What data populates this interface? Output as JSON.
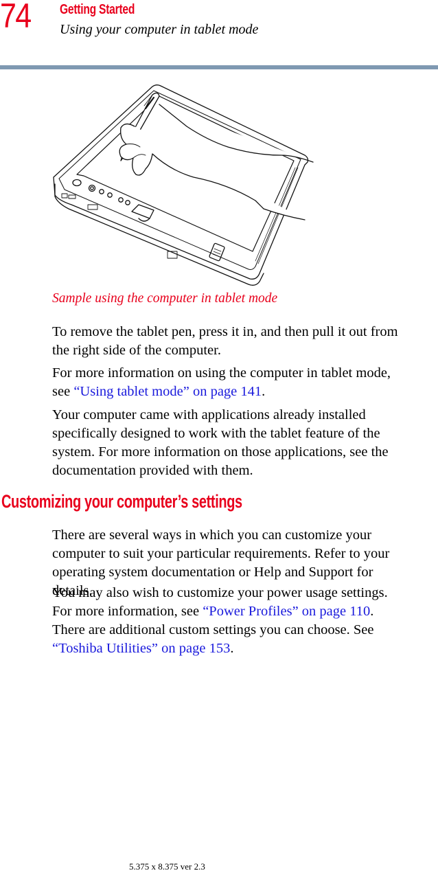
{
  "header": {
    "page_number": "74",
    "chapter": "Getting Started",
    "section": "Using your computer in tablet mode",
    "rule_color": "#7f99b2",
    "accent_color": "#e8001c"
  },
  "figure": {
    "icon": "tablet-pc-with-pen-illustration",
    "caption": "Sample using the computer in tablet mode"
  },
  "body": {
    "p1": {
      "line1": "To remove the tablet pen, press it in, and then pull it out from",
      "line2": "the right side of the computer."
    },
    "p2": {
      "line1": "For more information on using the computer in tablet mode,",
      "line2_prefix": "see ",
      "link": "“Using tablet mode” on page 141",
      "line2_suffix": "."
    },
    "p3": {
      "line1": "Your computer came with applications already installed",
      "line2": "specifically designed to work with the tablet feature of the",
      "line3": "system. For more information on those applications, see the",
      "line4": "documentation provided with them."
    },
    "heading2": "Customizing your computer’s settings",
    "p4": {
      "line1": "There are several ways in which you can customize your",
      "line2": "computer to suit your particular requirements. Refer to your",
      "line3": "operating system documentation or Help and Support for",
      "line4": "details."
    },
    "p5": {
      "line1": "You may also wish to customize your power usage settings.",
      "line2_prefix": "For more information, see ",
      "link1": "“Power Profiles” on page 110",
      "line2_suffix": ".",
      "line3": "There are additional custom settings you can choose. See",
      "link2": "“Toshiba Utilities” on page 153",
      "line4_suffix": "."
    },
    "link_color": "#1a1adc"
  },
  "footer": {
    "text": "5.375 x 8.375 ver 2.3"
  }
}
